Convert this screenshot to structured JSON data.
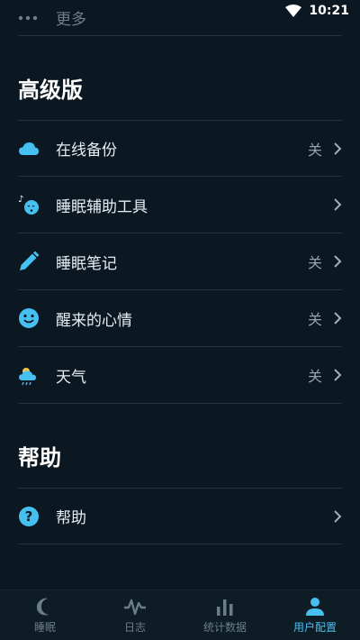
{
  "status": {
    "time": "10:21"
  },
  "top_item": {
    "label": "更多"
  },
  "sections": [
    {
      "title": "高级版",
      "items": [
        {
          "label": "在线备份",
          "value": "关",
          "icon": "cloud-icon"
        },
        {
          "label": "睡眠辅助工具",
          "value": "",
          "icon": "sleep-aid-icon"
        },
        {
          "label": "睡眠笔记",
          "value": "关",
          "icon": "pencil-icon"
        },
        {
          "label": "醒来的心情",
          "value": "关",
          "icon": "smiley-icon"
        },
        {
          "label": "天气",
          "value": "关",
          "icon": "weather-icon"
        }
      ]
    },
    {
      "title": "帮助",
      "items": [
        {
          "label": "帮助",
          "value": "",
          "icon": "help-icon"
        }
      ]
    }
  ],
  "bottom_nav": [
    {
      "label": "睡眠",
      "icon": "moon-icon",
      "active": false
    },
    {
      "label": "日志",
      "icon": "pulse-icon",
      "active": false
    },
    {
      "label": "统计数据",
      "icon": "bar-chart-icon",
      "active": false
    },
    {
      "label": "用户配置",
      "icon": "user-icon",
      "active": true
    }
  ],
  "colors": {
    "accent": "#46c0f0",
    "background": "#0b1822"
  }
}
